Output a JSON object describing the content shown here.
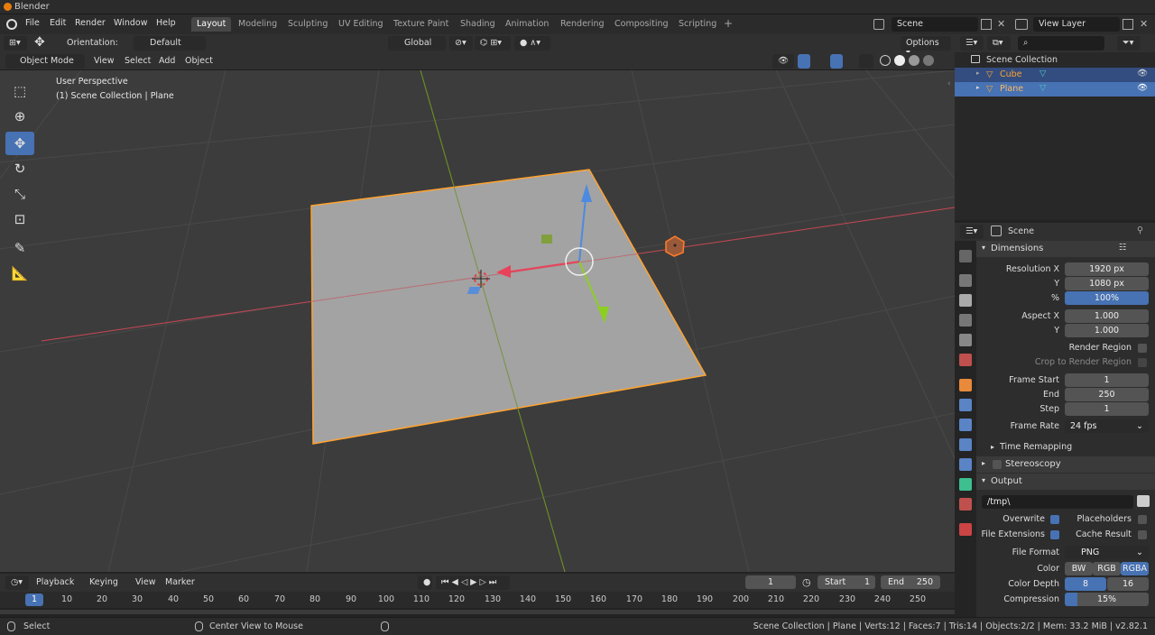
{
  "app": {
    "title": "Blender"
  },
  "menu": [
    "File",
    "Edit",
    "Render",
    "Window",
    "Help"
  ],
  "workspaces": [
    "Layout",
    "Modeling",
    "Sculpting",
    "UV Editing",
    "Texture Paint",
    "Shading",
    "Animation",
    "Rendering",
    "Compositing",
    "Scripting"
  ],
  "scene": {
    "name": "Scene",
    "view_layer": "View Layer"
  },
  "viewport_header": {
    "orientation_label": "Orientation:",
    "orientation_value": "Default",
    "transform_orientation": "Global",
    "options": "Options",
    "mode": "Object Mode",
    "menus": [
      "View",
      "Select",
      "Add",
      "Object"
    ]
  },
  "viewport": {
    "perspective": "User Perspective",
    "collection": "(1) Scene Collection | Plane"
  },
  "outliner": {
    "root": "Scene Collection",
    "items": [
      {
        "name": "Cube"
      },
      {
        "name": "Plane"
      }
    ]
  },
  "properties": {
    "context": "Scene",
    "dimensions": {
      "title": "Dimensions",
      "res_x_label": "Resolution X",
      "res_x": "1920 px",
      "res_y_label": "Y",
      "res_y": "1080 px",
      "pct_label": "%",
      "pct": "100%",
      "aspect_x_label": "Aspect X",
      "aspect_x": "1.000",
      "aspect_y_label": "Y",
      "aspect_y": "1.000",
      "render_region": "Render Region",
      "crop": "Crop to Render Region",
      "frame_start_label": "Frame Start",
      "frame_start": "1",
      "end_label": "End",
      "end": "250",
      "step_label": "Step",
      "step": "1",
      "frame_rate_label": "Frame Rate",
      "frame_rate": "24 fps",
      "time_remapping": "Time Remapping"
    },
    "stereoscopy": "Stereoscopy",
    "output": {
      "title": "Output",
      "path": "/tmp\\",
      "overwrite": "Overwrite",
      "placeholders": "Placeholders",
      "file_ext": "File Extensions",
      "cache": "Cache Result",
      "format_label": "File Format",
      "format": "PNG",
      "color_label": "Color",
      "color_opts": [
        "BW",
        "RGB",
        "RGBA"
      ],
      "depth_label": "Color Depth",
      "depth_opts": [
        "8",
        "16"
      ],
      "compression_label": "Compression",
      "compression": "15%"
    }
  },
  "timeline": {
    "menus": [
      "Playback",
      "Keying",
      "View",
      "Marker"
    ],
    "current_frame": "1",
    "start_label": "Start",
    "start": "1",
    "end_label": "End",
    "end": "250",
    "ticks": [
      "1",
      "10",
      "20",
      "30",
      "40",
      "50",
      "60",
      "70",
      "80",
      "90",
      "100",
      "110",
      "120",
      "130",
      "140",
      "150",
      "160",
      "170",
      "180",
      "190",
      "200",
      "210",
      "220",
      "230",
      "240",
      "250"
    ]
  },
  "status": {
    "select": "Select",
    "center": "Center View to Mouse",
    "info": "Scene Collection | Plane | Verts:12 | Faces:7 | Tris:14 | Objects:2/2 | Mem: 33.2 MiB | v2.82.1"
  },
  "colors": {
    "accent": "#4772b3",
    "selection": "#ffa32f",
    "x_axis": "#c84a56",
    "y_axis": "#7ba02c"
  }
}
